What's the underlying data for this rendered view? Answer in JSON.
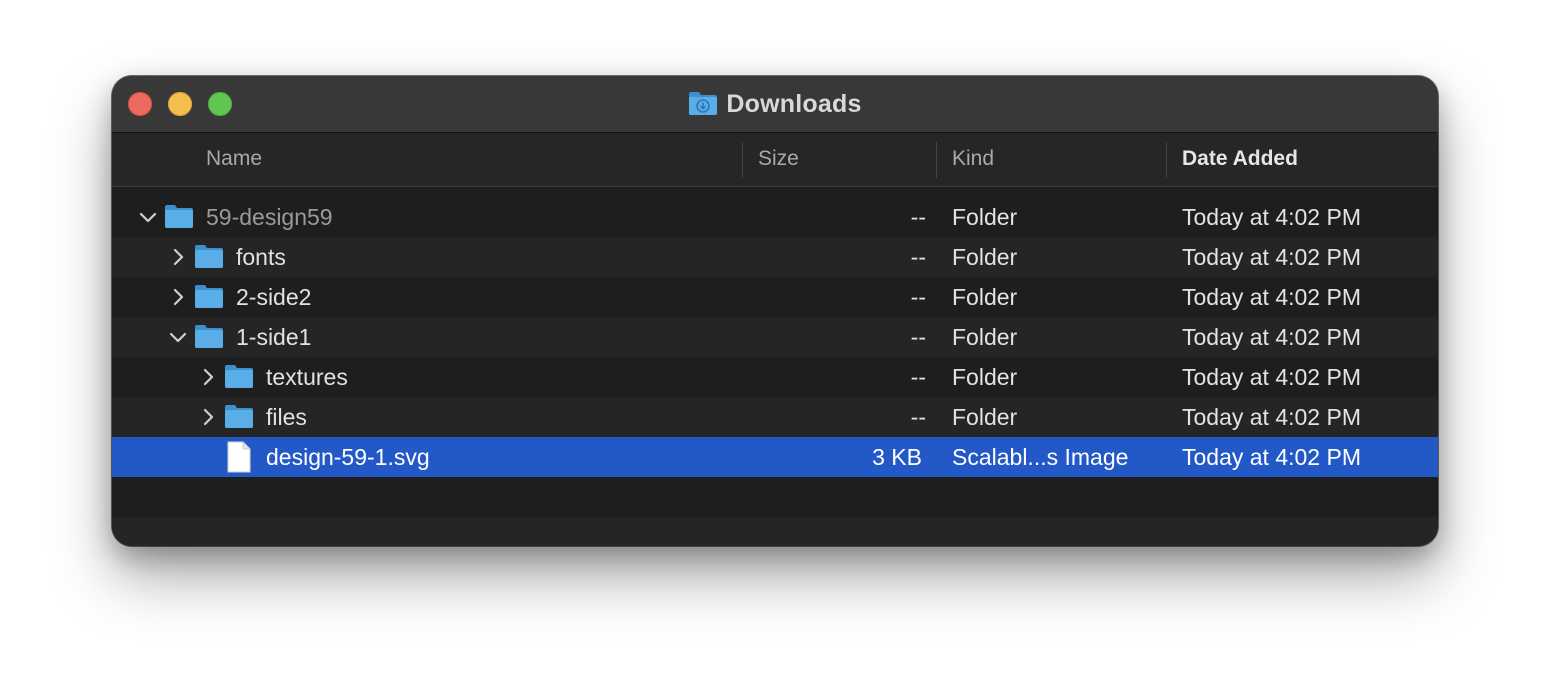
{
  "window": {
    "title": "Downloads",
    "title_icon": "downloads-folder-icon"
  },
  "columns": {
    "name": "Name",
    "size": "Size",
    "kind": "Kind",
    "date": "Date Added"
  },
  "rows": [
    {
      "name": "59-design59",
      "size": "--",
      "kind": "Folder",
      "date": "Today at 4:02 PM",
      "type": "folder",
      "expanded": true,
      "depth": 0
    },
    {
      "name": "fonts",
      "size": "--",
      "kind": "Folder",
      "date": "Today at 4:02 PM",
      "type": "folder",
      "expanded": false,
      "depth": 1
    },
    {
      "name": "2-side2",
      "size": "--",
      "kind": "Folder",
      "date": "Today at 4:02 PM",
      "type": "folder",
      "expanded": false,
      "depth": 1
    },
    {
      "name": "1-side1",
      "size": "--",
      "kind": "Folder",
      "date": "Today at 4:02 PM",
      "type": "folder",
      "expanded": true,
      "depth": 1
    },
    {
      "name": "textures",
      "size": "--",
      "kind": "Folder",
      "date": "Today at 4:02 PM",
      "type": "folder",
      "expanded": false,
      "depth": 2
    },
    {
      "name": "files",
      "size": "--",
      "kind": "Folder",
      "date": "Today at 4:02 PM",
      "type": "folder",
      "expanded": false,
      "depth": 2
    },
    {
      "name": "design-59-1.svg",
      "size": "3 KB",
      "kind": "Scalabl...s Image",
      "date": "Today at 4:02 PM",
      "type": "file",
      "selected": true,
      "depth": 2
    }
  ],
  "colors": {
    "selection": "#2359c7",
    "folder": "#5aaee8",
    "close": "#ed6a5e",
    "minimize": "#f5bf4f",
    "zoom": "#61c554"
  }
}
